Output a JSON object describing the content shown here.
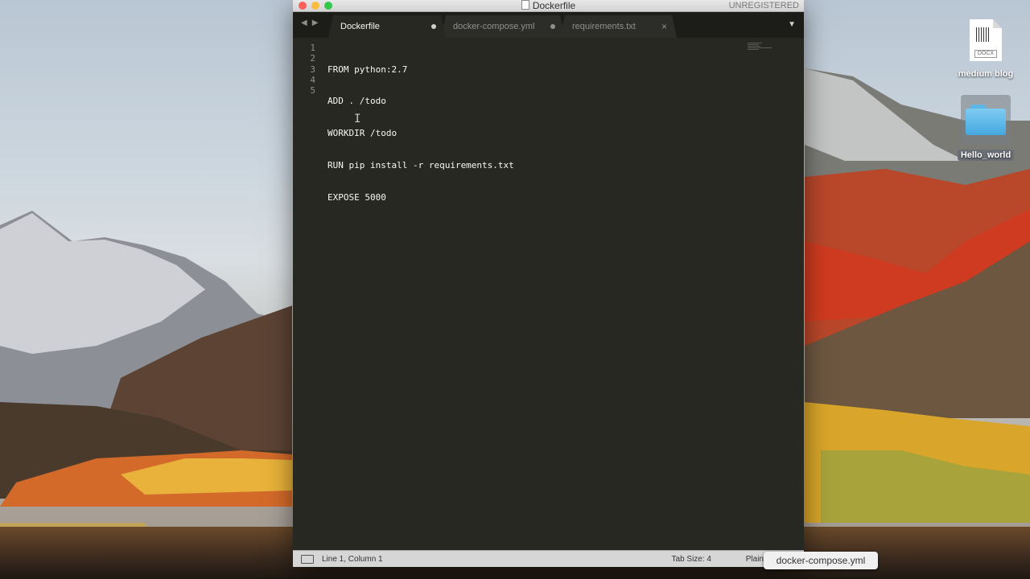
{
  "desktop": {
    "icons": [
      {
        "label": "medium blog",
        "kind": "docx",
        "badge": "DOCX"
      },
      {
        "label": "Hello_world",
        "kind": "folder"
      }
    ]
  },
  "window": {
    "title": "Dockerfile",
    "registration": "UNREGISTERED",
    "tabs": [
      {
        "label": "Dockerfile",
        "active": true,
        "modified": true
      },
      {
        "label": "docker-compose.yml",
        "active": false,
        "modified": true
      },
      {
        "label": "requirements.txt",
        "active": false,
        "modified": false
      }
    ],
    "editor": {
      "line_numbers": [
        "1",
        "2",
        "3",
        "4",
        "5"
      ],
      "lines": [
        "FROM python:2.7",
        "ADD . /todo",
        "WORKDIR /todo",
        "RUN pip install -r requirements.txt",
        "EXPOSE 5000"
      ]
    },
    "status": {
      "position": "Line 1, Column 1",
      "tab_size": "Tab Size: 4",
      "syntax": "Plain"
    }
  },
  "tooltip": "docker-compose.yml",
  "icons": {
    "nav_back": "chevron-left-icon",
    "nav_forward": "chevron-right-icon",
    "tab_menu": "triangle-down-icon",
    "close_tab": "close-icon",
    "modified": "dot-icon"
  }
}
